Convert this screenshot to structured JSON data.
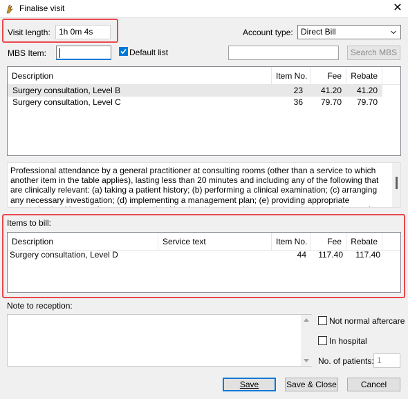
{
  "window": {
    "title": "Finalise visit",
    "close_glyph": "✕"
  },
  "visit": {
    "label": "Visit length:",
    "value": "1h 0m  4s"
  },
  "account": {
    "label": "Account type:",
    "value": "Direct Bill"
  },
  "mbs": {
    "label": "MBS Item:",
    "value": "",
    "default_list_label": "Default list",
    "default_list_checked": true,
    "search_value": "",
    "search_button": "Search MBS"
  },
  "mbs_list": {
    "columns": [
      "Description",
      "Item No.",
      "Fee",
      "Rebate"
    ],
    "rows": [
      {
        "description": "Surgery consultation, Level B",
        "item_no": "23",
        "fee": "41.20",
        "rebate": "41.20",
        "selected": true
      },
      {
        "description": "Surgery consultation, Level C",
        "item_no": "36",
        "fee": "79.70",
        "rebate": "79.70",
        "selected": false
      }
    ]
  },
  "item_description": "Professional attendance by a general practitioner at consulting rooms (other than a service to which another item in the table applies), lasting less than 20 minutes and including any of the following that are clinically relevant: (a) taking a patient history; (b) performing a clinical examination; (c) arranging any necessary investigation; (d) implementing a management plan; (e) providing appropriate preventive health care; for one or more health-related issues, with appropriate documentation-each attendance",
  "bill": {
    "label": "Items to bill:",
    "columns": [
      "Description",
      "Service text",
      "Item No.",
      "Fee",
      "Rebate"
    ],
    "rows": [
      {
        "description": "Surgery consultation, Level D",
        "service_text": "",
        "item_no": "44",
        "fee": "117.40",
        "rebate": "117.40"
      }
    ]
  },
  "note": {
    "label": "Note to reception:",
    "value": ""
  },
  "options": {
    "not_normal_aftercare": "Not normal aftercare",
    "in_hospital": "In hospital",
    "patients_label": "No. of patients:",
    "patients_value": "1"
  },
  "buttons": {
    "save": "Save",
    "save_close": "Save & Close",
    "cancel": "Cancel"
  },
  "colors": {
    "highlight": "#e8474d",
    "accent": "#0078d7"
  }
}
